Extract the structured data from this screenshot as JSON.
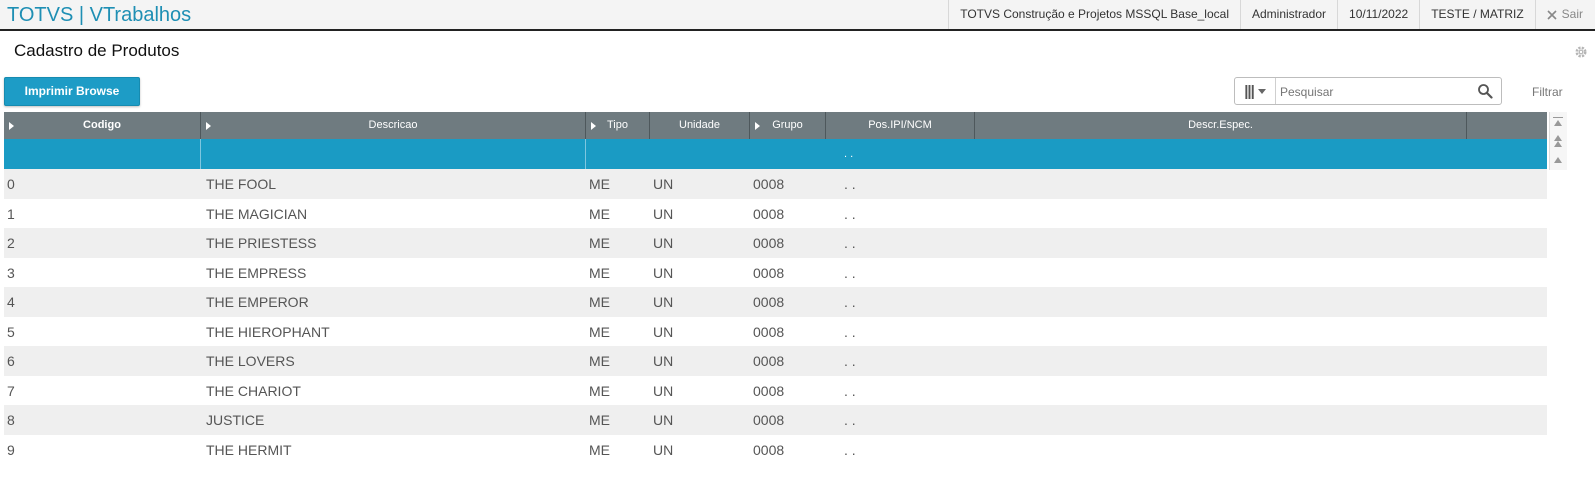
{
  "app": {
    "title": "TOTVS | VTrabalhos"
  },
  "topbar": {
    "company": "TOTVS Construção e Projetos MSSQL Base_local",
    "user": "Administrador",
    "date": "10/11/2022",
    "branch": "TESTE / MATRIZ",
    "exit_label": "Sair"
  },
  "page": {
    "title": "Cadastro de Produtos"
  },
  "toolbar": {
    "print_label": "Imprimir Browse",
    "filter_label": "Filtrar"
  },
  "search": {
    "placeholder": "Pesquisar",
    "value": ""
  },
  "grid": {
    "columns": [
      "Codigo",
      "Descricao",
      "Tipo",
      "Unidade",
      "Grupo",
      "Pos.IPI/NCM",
      "Descr.Espec."
    ],
    "selected_row": {
      "pos_ipi": ". ."
    },
    "rows": [
      {
        "codigo": "0",
        "descricao": "THE FOOL",
        "tipo": "ME",
        "unidade": "UN",
        "grupo": "0008",
        "pos_ipi": ". ."
      },
      {
        "codigo": "1",
        "descricao": "THE MAGICIAN",
        "tipo": "ME",
        "unidade": "UN",
        "grupo": "0008",
        "pos_ipi": ". ."
      },
      {
        "codigo": "2",
        "descricao": "THE PRIESTESS",
        "tipo": "ME",
        "unidade": "UN",
        "grupo": "0008",
        "pos_ipi": ". ."
      },
      {
        "codigo": "3",
        "descricao": "THE EMPRESS",
        "tipo": "ME",
        "unidade": "UN",
        "grupo": "0008",
        "pos_ipi": ". ."
      },
      {
        "codigo": "4",
        "descricao": "THE EMPEROR",
        "tipo": "ME",
        "unidade": "UN",
        "grupo": "0008",
        "pos_ipi": ". ."
      },
      {
        "codigo": "5",
        "descricao": "THE HIEROPHANT",
        "tipo": "ME",
        "unidade": "UN",
        "grupo": "0008",
        "pos_ipi": ". ."
      },
      {
        "codigo": "6",
        "descricao": "THE LOVERS",
        "tipo": "ME",
        "unidade": "UN",
        "grupo": "0008",
        "pos_ipi": ". ."
      },
      {
        "codigo": "7",
        "descricao": "THE CHARIOT",
        "tipo": "ME",
        "unidade": "UN",
        "grupo": "0008",
        "pos_ipi": ". ."
      },
      {
        "codigo": "8",
        "descricao": "JUSTICE",
        "tipo": "ME",
        "unidade": "UN",
        "grupo": "0008",
        "pos_ipi": ". ."
      },
      {
        "codigo": "9",
        "descricao": "THE HERMIT",
        "tipo": "ME",
        "unidade": "UN",
        "grupo": "0008",
        "pos_ipi": ". ."
      }
    ]
  },
  "colors": {
    "accent": "#1d9cc6",
    "header_bg": "#6f7b80",
    "selected_row": "#1a9bc4",
    "alt_row": "#efefef"
  }
}
